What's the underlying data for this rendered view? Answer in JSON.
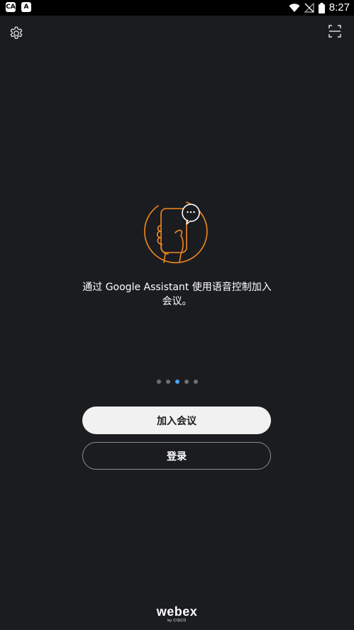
{
  "status_bar": {
    "left_icons": [
      "CA",
      "A"
    ],
    "time": "8:27",
    "icons": [
      "wifi-icon",
      "no-signal-icon",
      "battery-icon"
    ]
  },
  "top_bar": {
    "settings_icon": "gear-icon",
    "scan_icon": "scan-icon"
  },
  "onboarding": {
    "illustration_icon": "hand-phone-chat-icon",
    "description": "通过 Google Assistant 使用语音控制加入会议。",
    "pager": {
      "total": 5,
      "active_index": 2
    },
    "accent_color": "#f0891f"
  },
  "actions": {
    "join_meeting_label": "加入会议",
    "sign_in_label": "登录"
  },
  "footer": {
    "brand": "webex",
    "sub": "by CISCO"
  }
}
